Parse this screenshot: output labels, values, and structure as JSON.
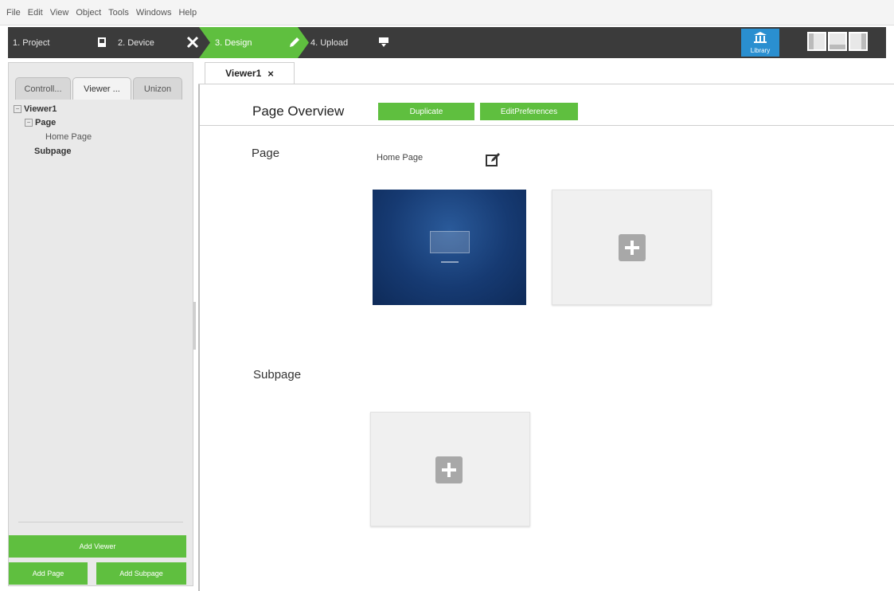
{
  "menu": [
    "File",
    "Edit",
    "View",
    "Object",
    "Tools",
    "Windows",
    "Help"
  ],
  "wizard": {
    "steps": [
      {
        "label": "1. Project"
      },
      {
        "label": "2. Device"
      },
      {
        "label": "3. Design"
      },
      {
        "label": "4. Upload"
      }
    ],
    "active_step": "3. Design",
    "active_color": "#5fbf3f"
  },
  "library": {
    "label": "Library",
    "icon": "library-icon"
  },
  "left_panel": {
    "tabs": [
      "Controll...",
      "Viewer ...",
      "Unizon"
    ],
    "active_tab": "Viewer ...",
    "tree": {
      "root": "Viewer1",
      "page": "Page",
      "home_page": "Home Page",
      "subpage": "Subpage"
    },
    "buttons": {
      "add_viewer": "Add Viewer",
      "add_page": "Add Page",
      "add_subpage": "Add Subpage"
    }
  },
  "document_tab": {
    "label": "Viewer1",
    "close": "×"
  },
  "overview": {
    "title": "Page Overview",
    "duplicate": "Duplicate",
    "edit_preferences": "EditPreferences",
    "page_section": "Page",
    "page_name": "Home Page",
    "subpage_section": "Subpage"
  },
  "colors": {
    "accent_green": "#5fbf3f",
    "library_blue": "#2a8fd0",
    "toolbar_dark": "#3b3b3b"
  }
}
